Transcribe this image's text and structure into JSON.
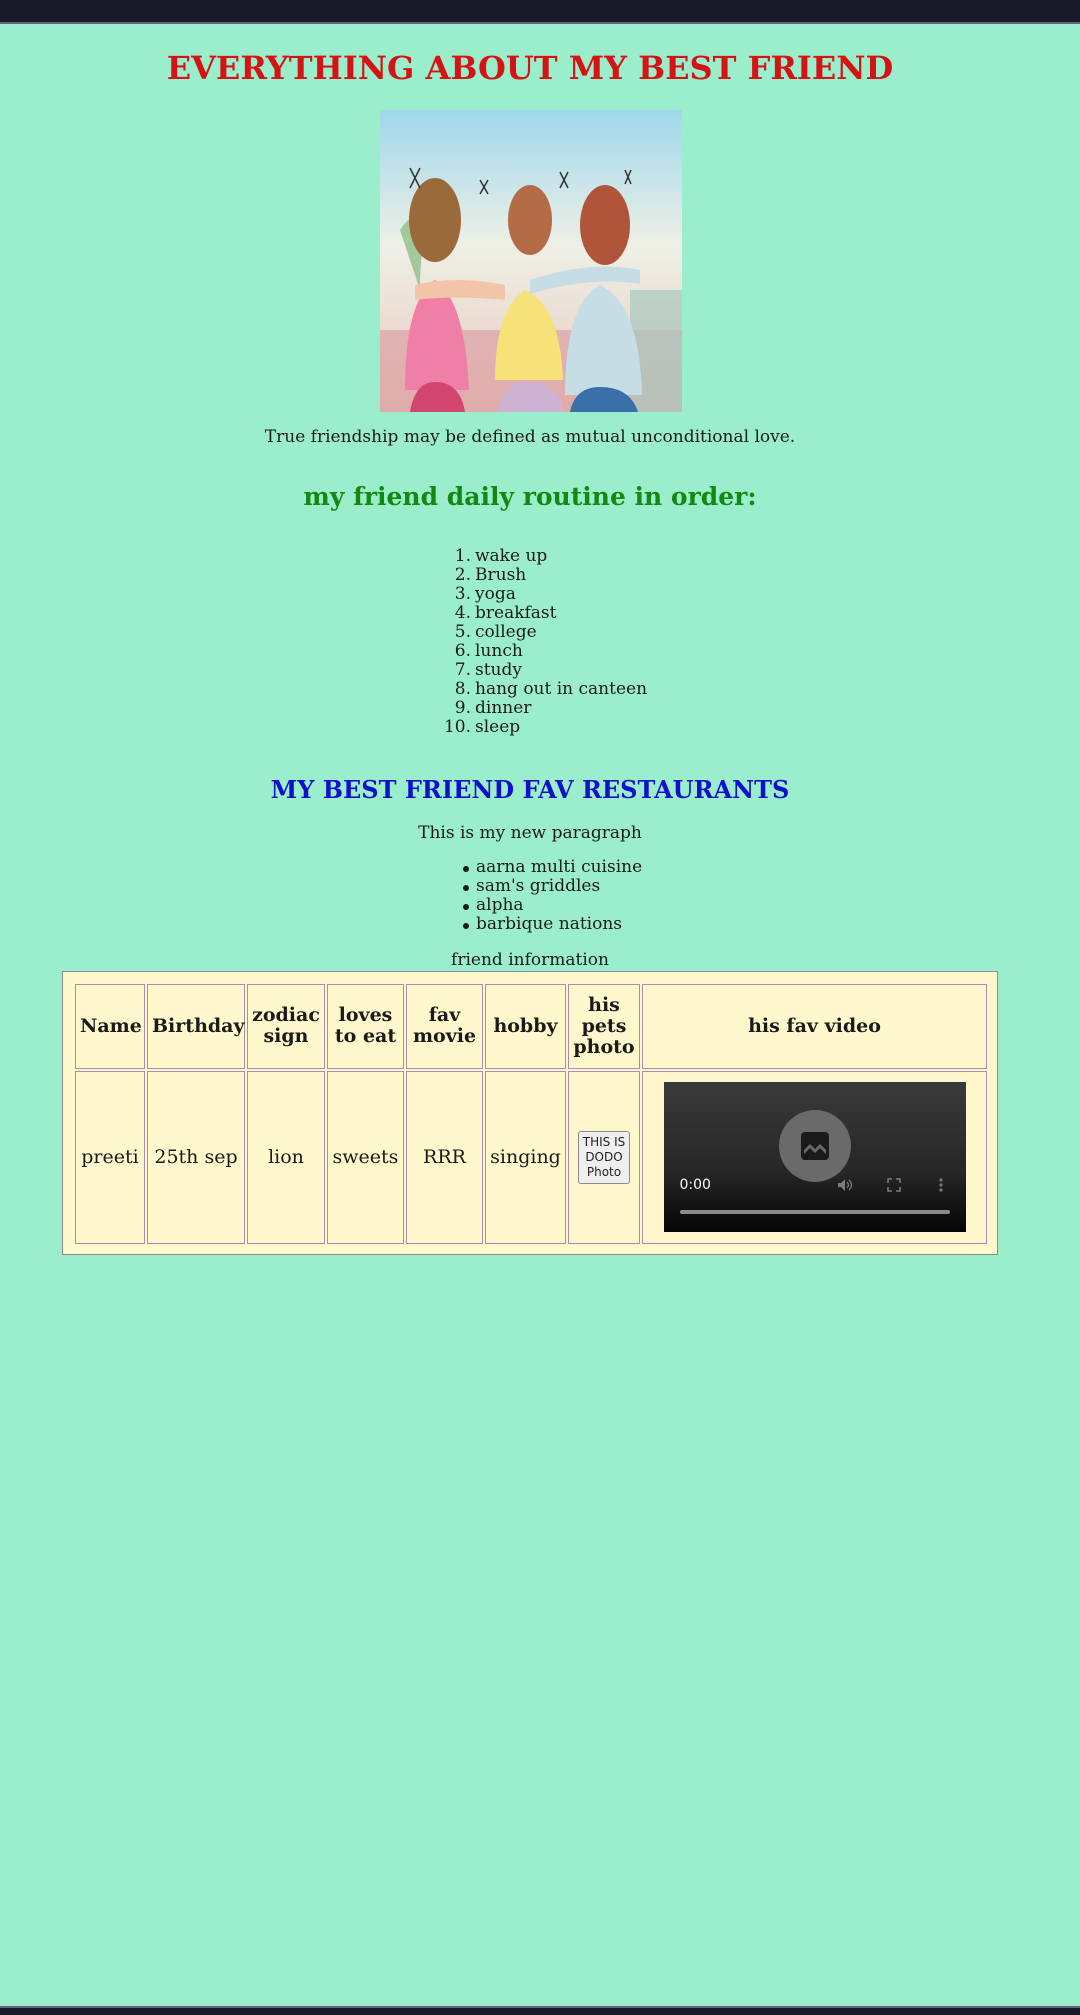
{
  "page": {
    "title": "EVERYTHING ABOUT MY BEST FRIEND",
    "caption": "True friendship may be defined as mutual unconditional love."
  },
  "hero_image": {
    "icon": "friends-illustration"
  },
  "routine": {
    "title": "my friend daily routine in order:",
    "items": [
      {
        "num": "1.",
        "text": "wake up"
      },
      {
        "num": "2.",
        "text": "Brush"
      },
      {
        "num": "3.",
        "text": "yoga"
      },
      {
        "num": "4.",
        "text": "breakfast"
      },
      {
        "num": "5.",
        "text": "college"
      },
      {
        "num": "6.",
        "text": "lunch"
      },
      {
        "num": "7.",
        "text": "study"
      },
      {
        "num": "8.",
        "text": "hang out in canteen"
      },
      {
        "num": "9.",
        "text": "dinner"
      },
      {
        "num": "10.",
        "text": "sleep"
      }
    ]
  },
  "restaurants": {
    "title": "MY BEST FRIEND FAV RESTAURANTS",
    "paragraph": "This is my new paragraph",
    "items": [
      "aarna multi cuisine",
      "sam's griddles",
      "alpha",
      "barbique nations"
    ]
  },
  "table": {
    "caption": "friend information",
    "headers": [
      "Name",
      "Birthday",
      "zodiac sign",
      "loves to eat",
      "fav movie",
      "hobby",
      "his pets photo",
      "his fav video"
    ],
    "row": {
      "name": "preeti",
      "birthday": "25th sep",
      "zodiac": "lion",
      "loves_to_eat": "sweets",
      "fav_movie": "RRR",
      "hobby": "singing",
      "pet_photo_button": "THIS IS DODO Photo"
    }
  },
  "video": {
    "time": "0:00",
    "icons": [
      "broken-media-icon",
      "volume-icon",
      "fullscreen-icon",
      "more-options-icon"
    ]
  },
  "colors": {
    "background": "#9beecb",
    "title_red": "#d41414",
    "routine_green": "#138813",
    "restaurant_blue": "#1010cc",
    "table_fill": "#fff8cc"
  }
}
